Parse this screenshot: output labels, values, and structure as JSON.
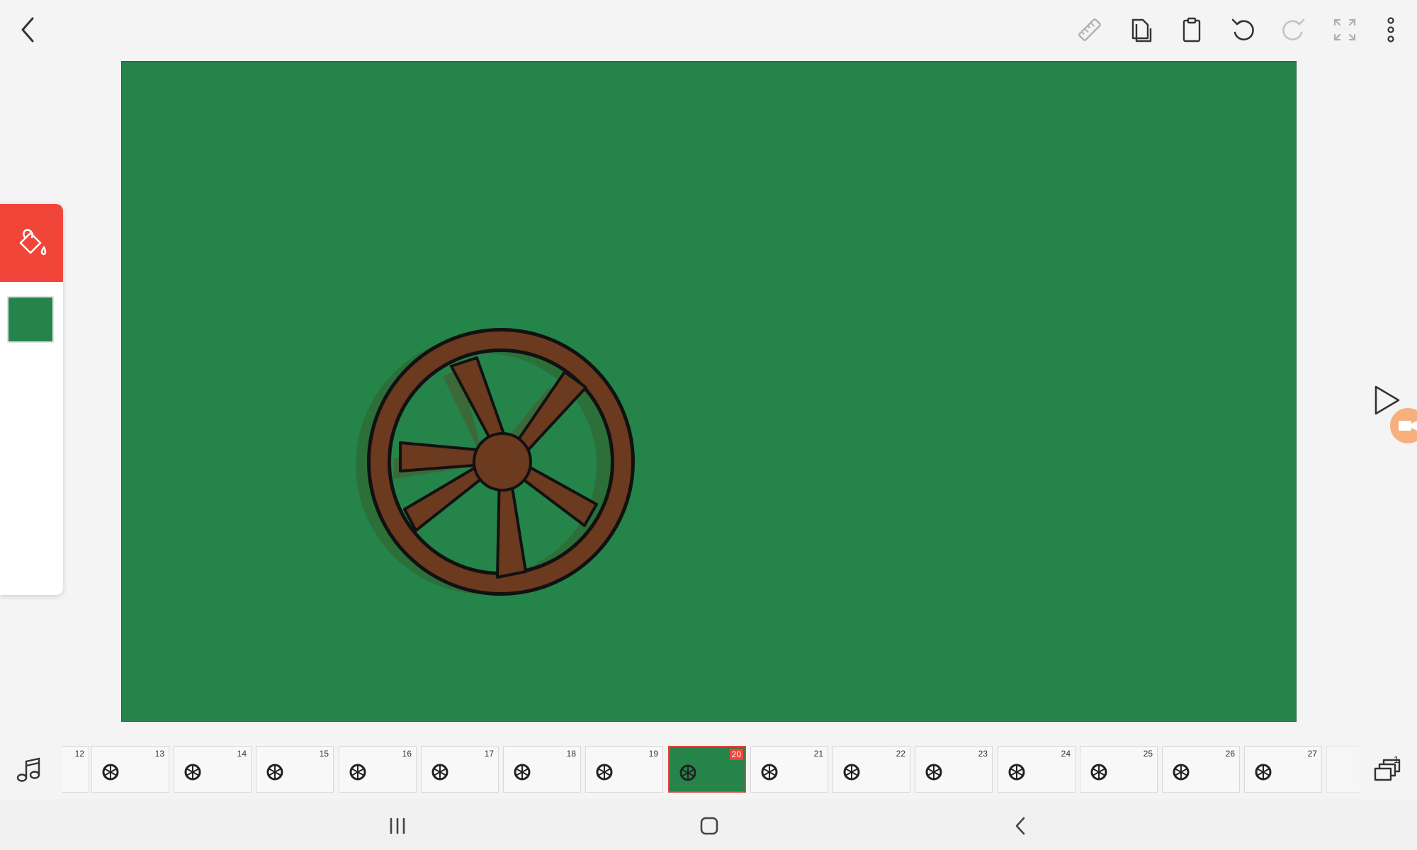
{
  "toolbar": {
    "icons": [
      "back-icon",
      "ruler-icon",
      "copy-icon",
      "paste-icon",
      "undo-icon",
      "redo-icon",
      "fullscreen-icon",
      "more-icon"
    ]
  },
  "canvas": {
    "background_color": "#24844a"
  },
  "side_panel": {
    "active_tool": "fill-bucket-icon",
    "active_tool_color": "#f1453a",
    "selected_color": "#24844a"
  },
  "timeline": {
    "current_frame": "20",
    "frames": [
      "12",
      "13",
      "14",
      "15",
      "16",
      "17",
      "18",
      "19",
      "20",
      "21",
      "22",
      "23",
      "24",
      "25",
      "26",
      "27"
    ],
    "layer_count": "1"
  },
  "colors": {
    "accent": "#f1453a",
    "wheel": "#6b3a1f",
    "record": "#f6b07e"
  }
}
